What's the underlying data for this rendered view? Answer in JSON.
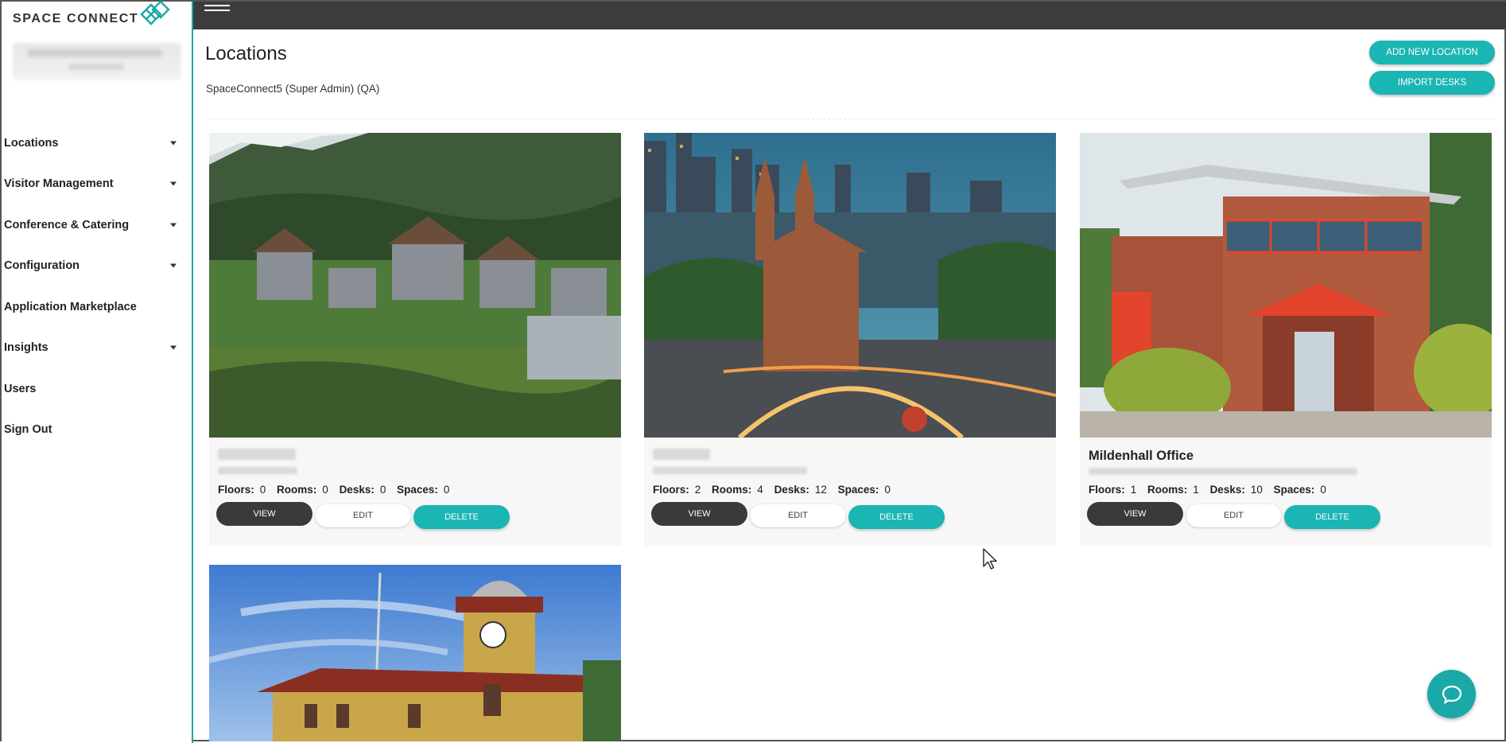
{
  "brand": {
    "name": "SPACE CONNECT",
    "accent": "#1aa9a8"
  },
  "sidebar": {
    "items": [
      {
        "label": "Locations",
        "has_caret": true
      },
      {
        "label": "Visitor Management",
        "has_caret": true
      },
      {
        "label": "Conference & Catering",
        "has_caret": true
      },
      {
        "label": "Configuration",
        "has_caret": true
      },
      {
        "label": "Application Marketplace",
        "has_caret": false
      },
      {
        "label": "Insights",
        "has_caret": true
      },
      {
        "label": "Users",
        "has_caret": false
      },
      {
        "label": "Sign Out",
        "has_caret": false
      }
    ]
  },
  "header": {
    "title": "Locations",
    "subtitle": "SpaceConnect5 (Super Admin) (QA)",
    "add_label": "ADD NEW LOCATION",
    "import_label": "IMPORT DESKS"
  },
  "labels": {
    "floors": "Floors:",
    "rooms": "Rooms:",
    "desks": "Desks:",
    "spaces": "Spaces:",
    "view": "VIEW",
    "edit": "EDIT",
    "delete": "DELETE"
  },
  "locations": [
    {
      "name": "",
      "image": "alaska-town",
      "floors": "0",
      "rooms": "0",
      "desks": "0",
      "spaces": "0"
    },
    {
      "name": "",
      "image": "saigon-cathedral",
      "floors": "2",
      "rooms": "4",
      "desks": "12",
      "spaces": "0"
    },
    {
      "name": "Mildenhall Office",
      "image": "brick-office",
      "floors": "1",
      "rooms": "1",
      "desks": "10",
      "spaces": "0"
    },
    {
      "name": "",
      "image": "clock-tower",
      "floors": "",
      "rooms": "",
      "desks": "",
      "spaces": ""
    }
  ]
}
